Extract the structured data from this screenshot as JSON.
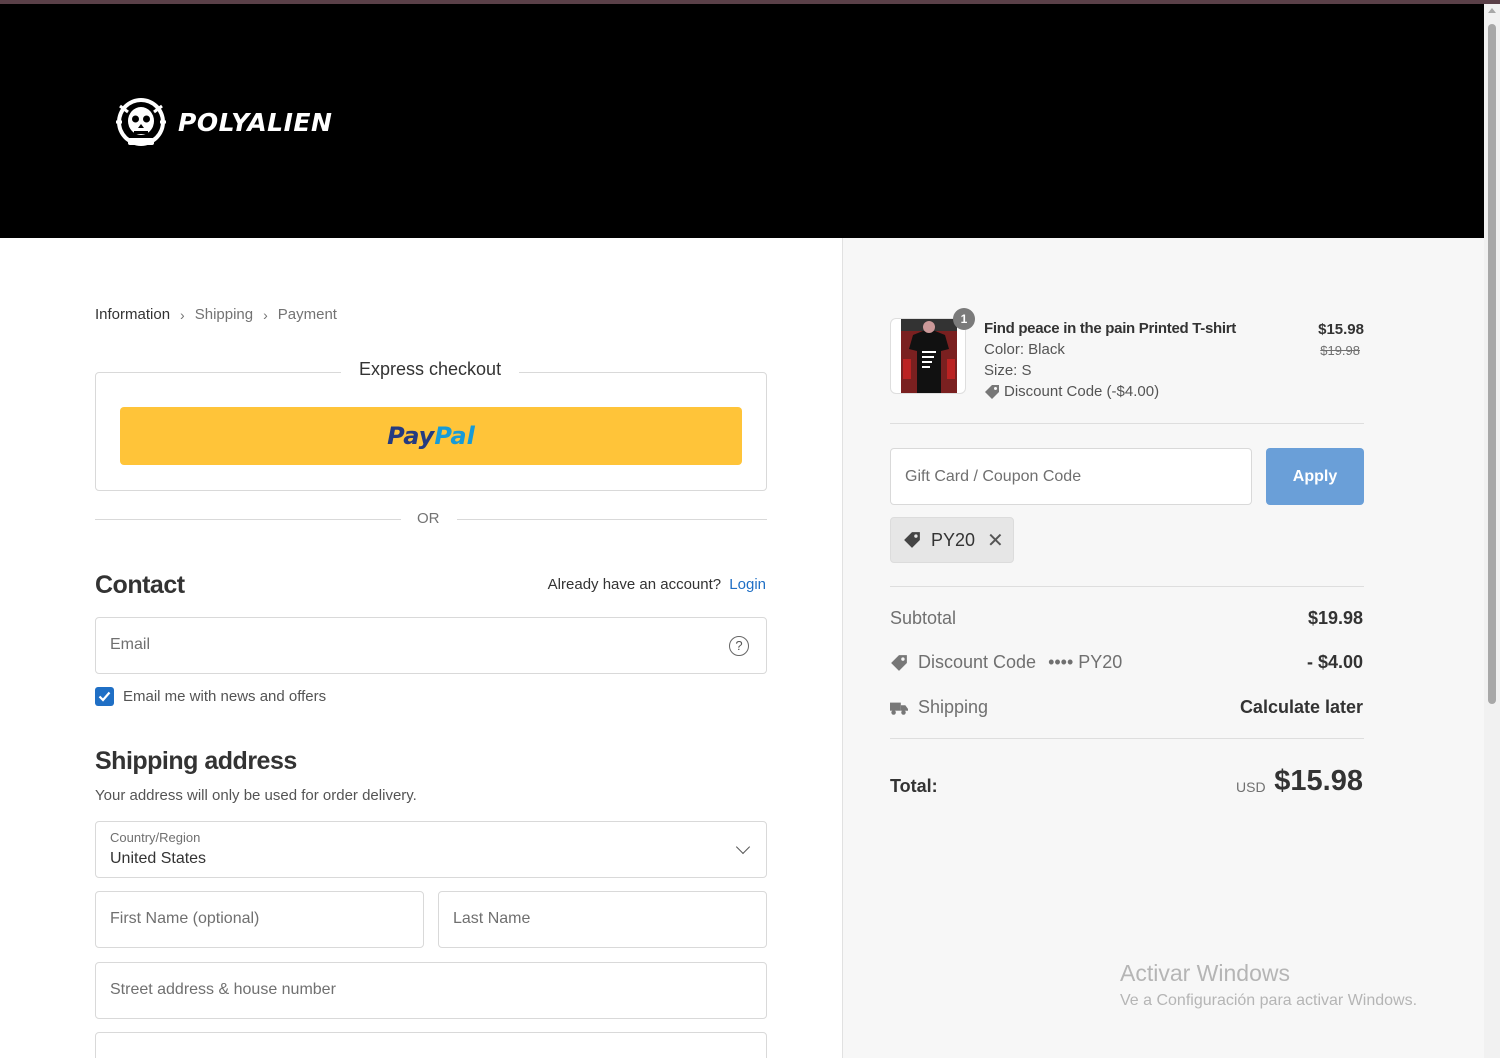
{
  "brand": {
    "name": "POLYALIEN"
  },
  "breadcrumb": [
    {
      "label": "Information",
      "active": true
    },
    {
      "label": "Shipping",
      "active": false
    },
    {
      "label": "Payment",
      "active": false
    }
  ],
  "express": {
    "title": "Express checkout",
    "paypal_pay": "Pay",
    "paypal_pal": "Pal"
  },
  "or_text": "OR",
  "contact": {
    "title": "Contact",
    "account_prompt": "Already have an account?",
    "login_label": "Login",
    "email_placeholder": "Email",
    "newsletter_label": "Email me with news and offers",
    "newsletter_checked": true
  },
  "shipping": {
    "title": "Shipping address",
    "subtitle": "Your address will only be used for order delivery.",
    "country_label": "Country/Region",
    "country_value": "United States",
    "first_name_placeholder": "First Name (optional)",
    "last_name_placeholder": "Last Name",
    "street_placeholder": "Street address & house number"
  },
  "order": {
    "product": {
      "quantity": "1",
      "name": "Find peace in the pain Printed T-shirt",
      "color": "Color: Black",
      "size": "Size: S",
      "discount": "Discount Code (-$4.00)",
      "price": "$15.98",
      "original_price": "$19.98"
    },
    "coupon_placeholder": "Gift Card / Coupon Code",
    "apply_label": "Apply",
    "applied_code": "PY20",
    "subtotal_label": "Subtotal",
    "subtotal_value": "$19.98",
    "discount_label": "Discount Code",
    "discount_code": "•••• PY20",
    "discount_value": "- $4.00",
    "shipping_label": "Shipping",
    "shipping_value": "Calculate later",
    "total_label": "Total:",
    "currency": "USD",
    "total_value": "$15.98"
  },
  "watermark": {
    "title": "Activar Windows",
    "subtitle": "Ve a Configuración para activar Windows."
  },
  "colors": {
    "header_bg": "#000000",
    "paypal_yellow": "#ffc439",
    "link_blue": "#1f6fc5",
    "apply_blue": "#6a9fd8"
  }
}
